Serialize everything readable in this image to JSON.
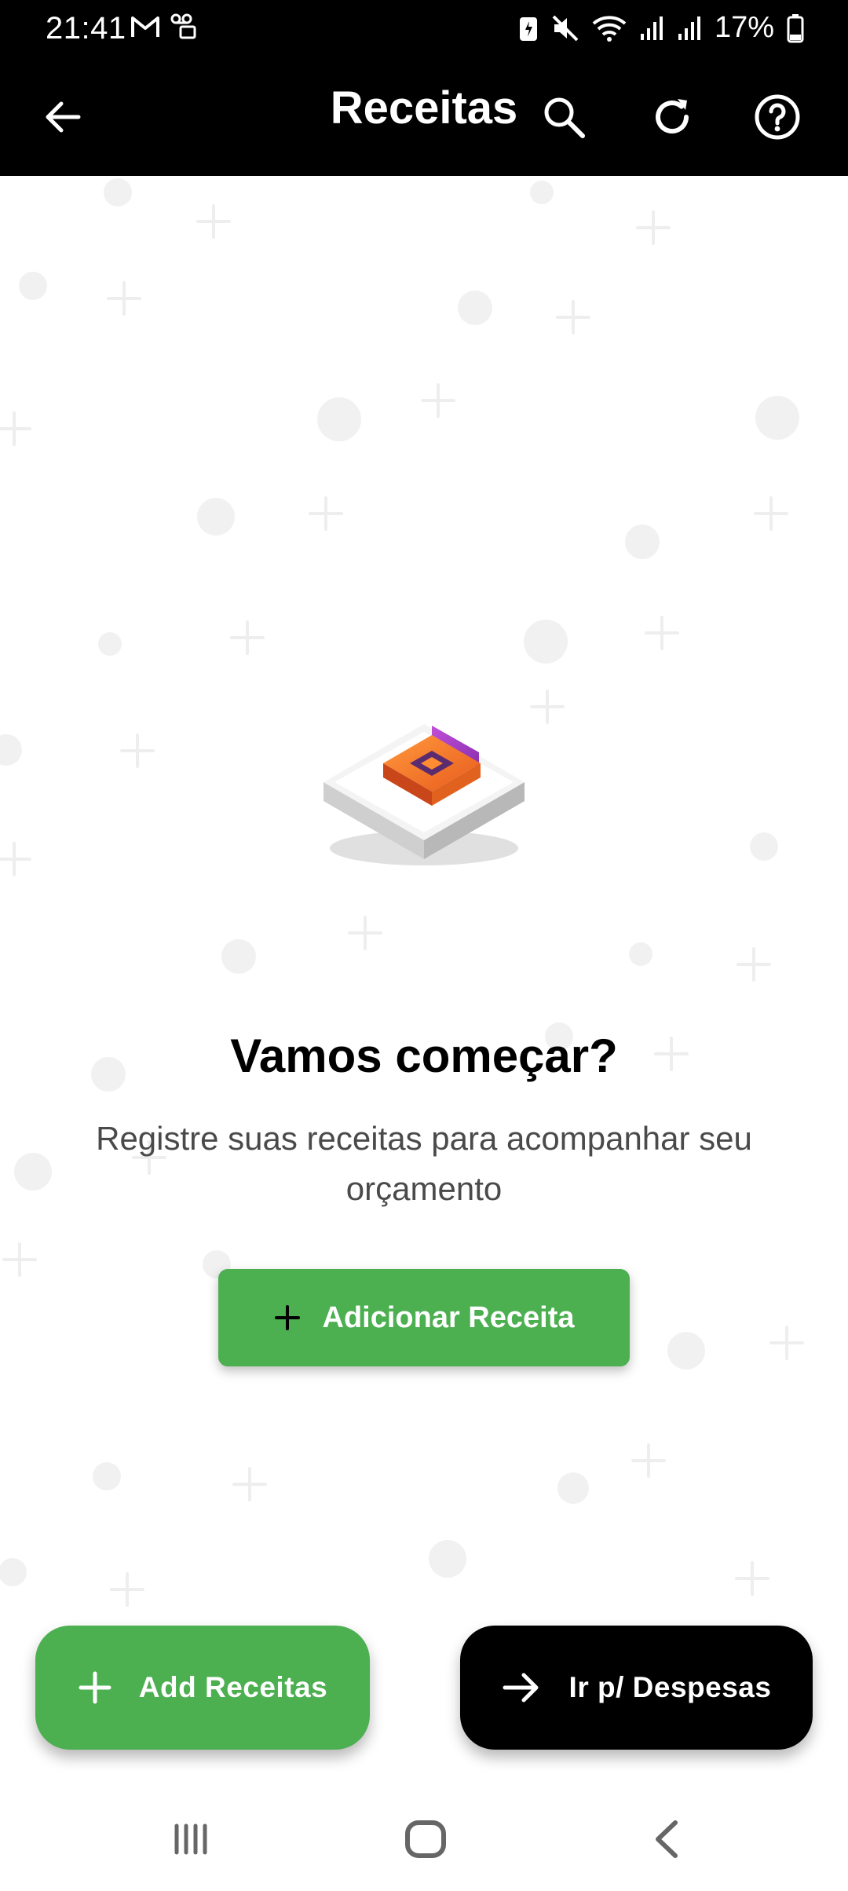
{
  "status_bar": {
    "time": "21:41",
    "battery_text": "17%",
    "icons": [
      "gmail-icon",
      "voicemail-icon",
      "battery-saver-icon",
      "mute-icon",
      "wifi-icon",
      "signal-icon",
      "signal-icon",
      "battery-icon"
    ]
  },
  "appbar": {
    "title": "Receitas",
    "icons": [
      "back-arrow-icon",
      "search-icon",
      "refresh-icon",
      "help-icon"
    ]
  },
  "empty_state": {
    "title": "Vamos começar?",
    "text": "Registre suas receitas para acompanhar seu orçamento",
    "button_label": "Adicionar Receita",
    "button_icon": "plus-icon"
  },
  "fabs": {
    "add_label": "Add Receitas",
    "add_icon": "plus-icon",
    "go_label": "Ir p/ Despesas",
    "go_icon": "arrow-right-icon"
  },
  "navbar": {
    "icons": [
      "recent-apps-icon",
      "home-icon",
      "back-icon"
    ]
  },
  "colors": {
    "bar": "#000000",
    "accent_green": "#4caf50",
    "background": "#ffffff",
    "pattern": "#f0f0f0",
    "text_secondary": "#4a4a4a"
  }
}
